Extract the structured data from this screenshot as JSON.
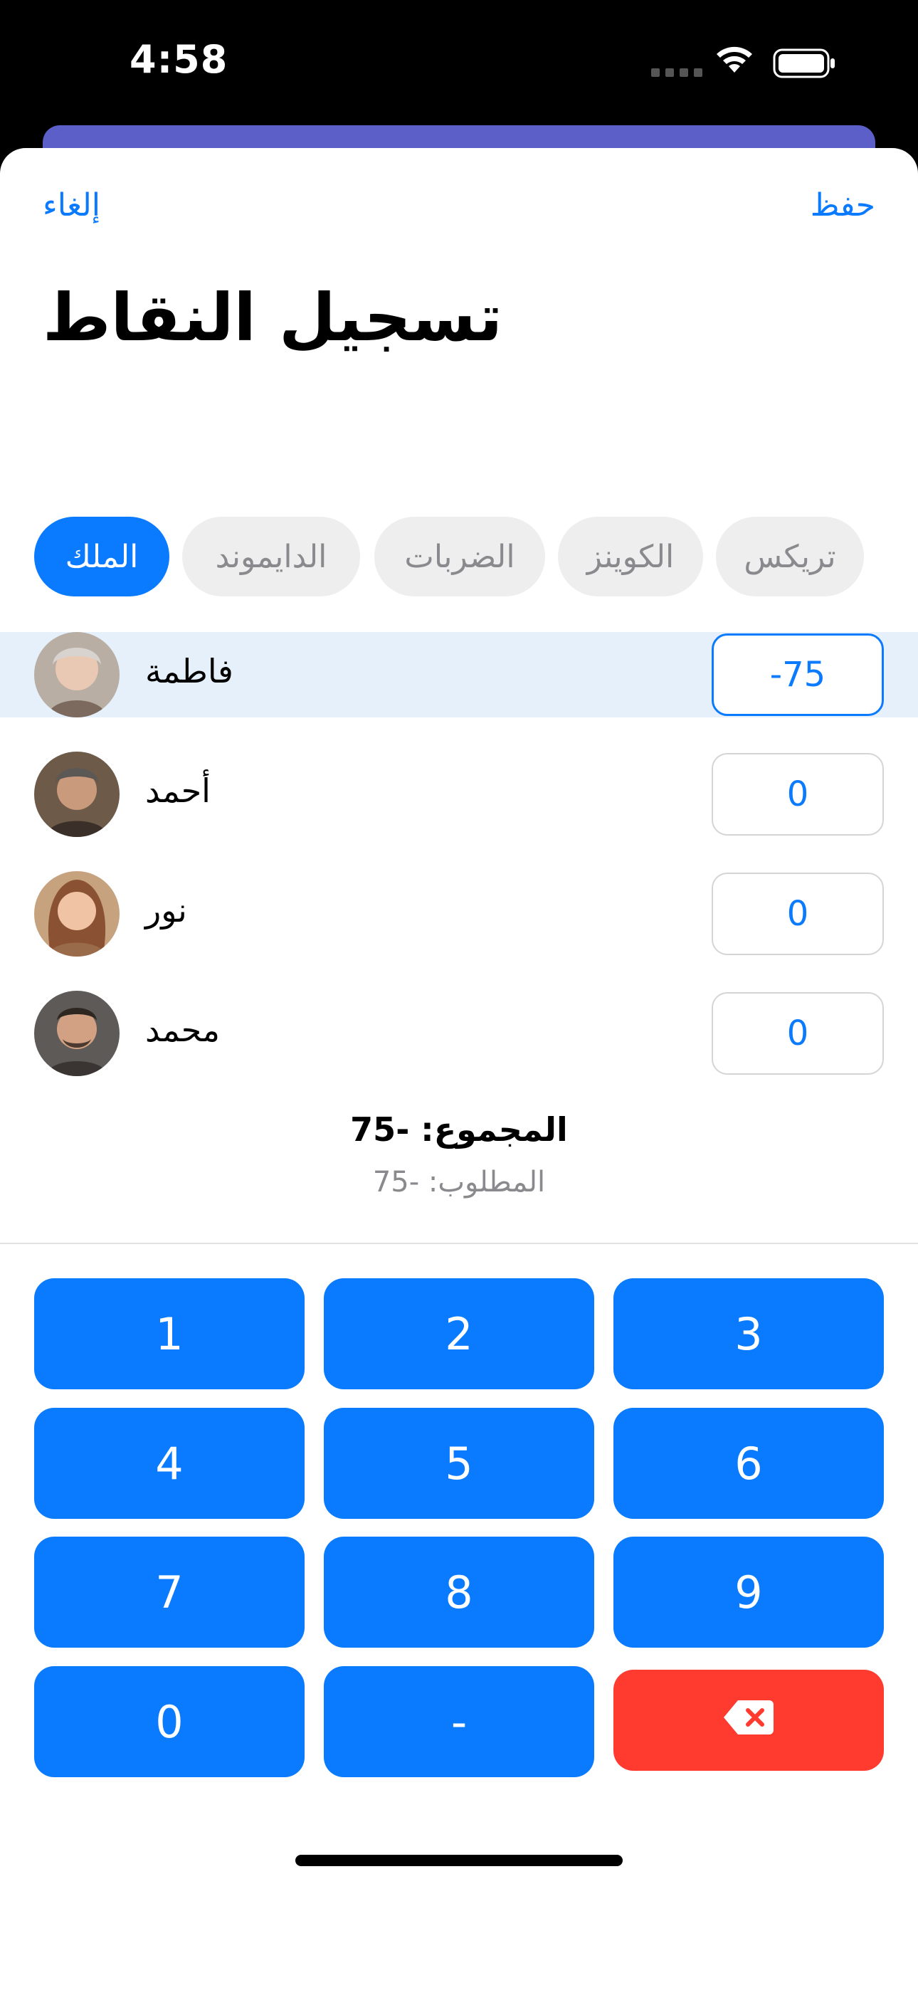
{
  "status": {
    "time": "4:58"
  },
  "header": {
    "cancel": "إلغاء",
    "save": "حفظ",
    "title": "تسجيل النقاط"
  },
  "tabs": [
    "تريكس",
    "الكوينز",
    "الضربات",
    "الدايموند",
    "الملك"
  ],
  "active_tab": "الملك",
  "players": [
    {
      "name": "فاطمة",
      "score": "-75",
      "selected": true
    },
    {
      "name": "أحمد",
      "score": "0",
      "selected": false
    },
    {
      "name": "نور",
      "score": "0",
      "selected": false
    },
    {
      "name": "محمد",
      "score": "0",
      "selected": false
    }
  ],
  "summary": {
    "total": "المجموع: -75",
    "required": "المطلوب: -75"
  },
  "keypad": [
    "1",
    "2",
    "3",
    "4",
    "5",
    "6",
    "7",
    "8",
    "9",
    "0",
    "-"
  ],
  "keypad_delete_icon": "backspace-icon",
  "colors": {
    "accent": "#0a7aff",
    "delete": "#ff3b30",
    "selected_row": "#e6f0fb"
  }
}
